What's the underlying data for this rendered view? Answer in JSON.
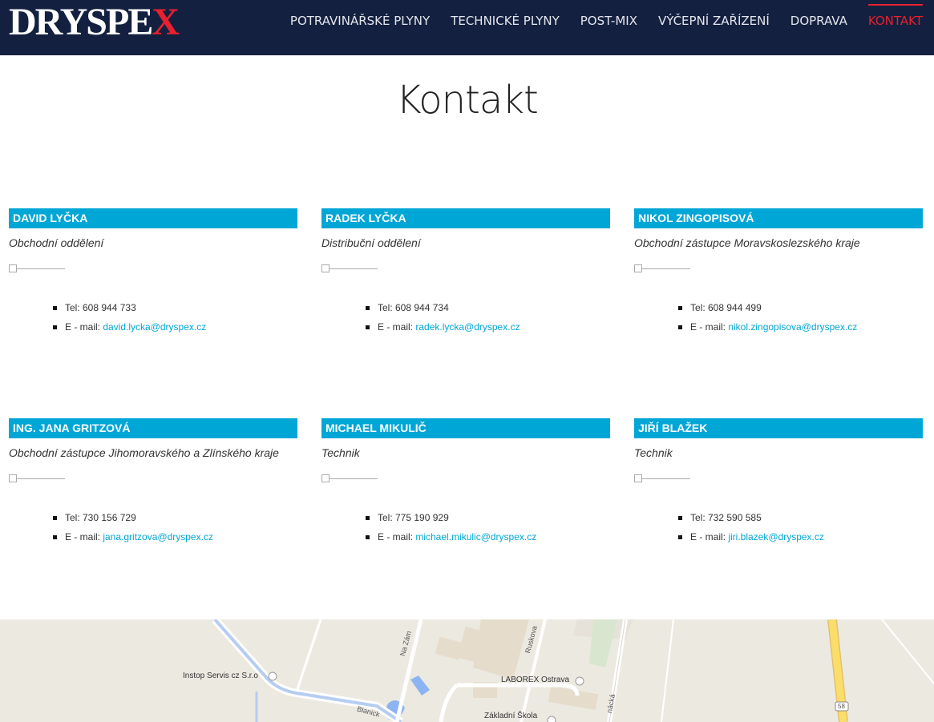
{
  "header": {
    "logo_main": "DRYSPE",
    "logo_x": "X",
    "nav": [
      {
        "label": "POTRAVINÁŘSKÉ PLYNY"
      },
      {
        "label": "TECHNICKÉ PLYNY"
      },
      {
        "label": "POST-MIX"
      },
      {
        "label": "VÝČEPNÍ ZAŘÍZENÍ"
      },
      {
        "label": "DOPRAVA"
      },
      {
        "label": "KONTAKT",
        "active": true
      }
    ]
  },
  "page_title": "Kontakt",
  "contacts": [
    {
      "name": "DAVID LYČKA",
      "role": "Obchodní oddělení",
      "tel": "Tel: 608 944 733",
      "email_label": "E - mail: ",
      "email": "david.lycka@dryspex.cz"
    },
    {
      "name": "RADEK LYČKA",
      "role": "Distribuční oddělení",
      "tel": "Tel: 608 944 734",
      "email_label": "E - mail: ",
      "email": "radek.lycka@dryspex.cz"
    },
    {
      "name": "NIKOL ZINGOPISOVÁ",
      "role": "Obchodní zástupce Moravskoslezského kraje",
      "tel": "Tel: 608 944 499",
      "email_label": "E - mail: ",
      "email": "nikol.zingopisova@dryspex.cz"
    },
    {
      "name": "ING. JANA GRITZOVÁ",
      "role": "Obchodní zástupce Jihomoravského a Zlínského kraje",
      "tel": "Tel: 730 156 729",
      "email_label": "E - mail: ",
      "email": "jana.gritzova@dryspex.cz"
    },
    {
      "name": "MICHAEL MIKULIČ",
      "role": "Technik",
      "tel": "Tel: 775 190 929",
      "email_label": "E - mail: ",
      "email": "michael.mikulic@dryspex.cz"
    },
    {
      "name": "JIŘÍ BLAŽEK",
      "role": "Technik",
      "tel": "Tel: 732 590 585",
      "email_label": "E - mail: ",
      "email": "jiri.blazek@dryspex.cz"
    }
  ],
  "map": {
    "labels": {
      "instop": "Instop Servis cz S.r.o",
      "laborex": "LABOREX Ostrava",
      "skola": "Základní Škola",
      "na_zam": "Na Zám",
      "ruskova": "Ruskova",
      "blanicka": "Blanick",
      "macka": "nácká",
      "road58": "58"
    }
  },
  "colors": {
    "header_bg": "#14203f",
    "accent_red": "#e8202f",
    "accent_blue": "#00a6d6"
  }
}
